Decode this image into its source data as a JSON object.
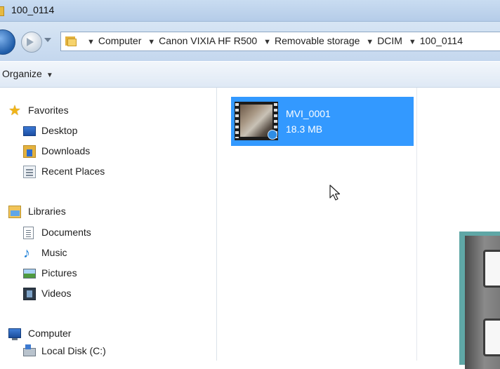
{
  "window": {
    "title": "100_0114"
  },
  "address_bar": {
    "crumbs": [
      "Computer",
      "Canon VIXIA HF R500",
      "Removable storage",
      "DCIM",
      "100_0114"
    ]
  },
  "toolbar": {
    "organize_label": "Organize"
  },
  "nav_pane": {
    "favorites": {
      "label": "Favorites",
      "items": [
        {
          "label": "Desktop",
          "icon": "desktop-icon"
        },
        {
          "label": "Downloads",
          "icon": "downloads-icon"
        },
        {
          "label": "Recent Places",
          "icon": "recent-places-icon"
        }
      ]
    },
    "libraries": {
      "label": "Libraries",
      "items": [
        {
          "label": "Documents",
          "icon": "documents-icon"
        },
        {
          "label": "Music",
          "icon": "music-icon"
        },
        {
          "label": "Pictures",
          "icon": "pictures-icon"
        },
        {
          "label": "Videos",
          "icon": "videos-icon"
        }
      ]
    },
    "computer": {
      "label": "Computer",
      "items": [
        {
          "label": "Local Disk (C:)",
          "icon": "local-disk-icon"
        }
      ]
    }
  },
  "files": [
    {
      "name": "MVI_0001",
      "size": "18.3 MB",
      "selected": true,
      "icon": "video-thumbnail-icon"
    }
  ],
  "colors": {
    "selection": "#3399ff",
    "titlebar": "#c9dcf1"
  }
}
